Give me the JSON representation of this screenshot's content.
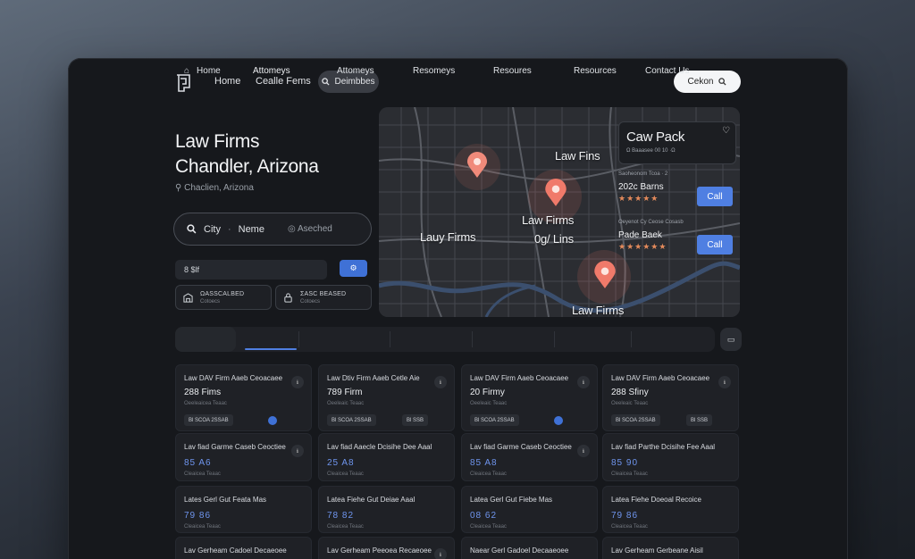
{
  "nav": {
    "home": "Home",
    "link2": "Cealle Fems",
    "pill": "Deimbbes",
    "search": "Cekon"
  },
  "hero": {
    "title_line1": "Law Firms",
    "title_line2": "Chandler, Arizona",
    "location": "Chaclien, Arizona"
  },
  "search": {
    "city": "City",
    "sep": "·",
    "name": "Neme",
    "checked": "Aseched"
  },
  "filter": {
    "value": "8 $lf"
  },
  "chips": [
    {
      "l1": "ΩASSCALBED",
      "l2": "Cotoecs"
    },
    {
      "l1": "ΣASC BEASED",
      "l2": "Cotoecs"
    }
  ],
  "map": {
    "labels": [
      "Law Fins",
      "Law Firms",
      "Lauy Firms",
      "0g/ Lins",
      "Law Firms"
    ],
    "card_title": "Caw Pack",
    "card_sub": "Ω Baaasee 00  10 ·Ω",
    "side1_small": "Saoheonom Tcoa · 2",
    "side1_name": "202c Barns",
    "side1_stars": "★★★★★",
    "side2_small": "Oeyenot Cy Ceose Cosasb",
    "side2_name": "Pade Baek",
    "side2_stars": "★★★★★★",
    "call": "Call"
  },
  "tabs": [
    "Home",
    "Attomeys",
    "Attomeys",
    "Resomeys",
    "Resoures",
    "Resources",
    "Contact Us"
  ],
  "cards_row1": [
    {
      "h": "Law DAV Firm Aaeb Ceoacaee",
      "n": "288 Fims",
      "m": "Oeeleaicea Teaac",
      "b1": "Bl  SCOA 2SSAB",
      "b2": "",
      "dot": true
    },
    {
      "h": "Law Dtiv Firm Aaeb Cetle Aie",
      "n": "789 Firm",
      "m": "Oeeleaic Teaac",
      "b1": "Bl  SCOA 2SSAB",
      "b2": "Bl  SSB",
      "dot": false
    },
    {
      "h": "Law DAV Firm Aaeb Ceoacaee",
      "n": "20 Firmy",
      "m": "Oeeleaic Teaac",
      "b1": "Bl  SCOA 2SSAB",
      "b2": "",
      "dot": true
    },
    {
      "h": "Law DAV Firm Aaeb Ceoacaee",
      "n": "288 Sfiny",
      "m": "Oeeleaic Teaac",
      "b1": "Bl  SCOA 2SSAB",
      "b2": "Bl  SSB",
      "dot": false
    }
  ],
  "cards_row2": [
    {
      "h": "Lav fiad Garme Caseb Ceoctiee",
      "v": "85 A6",
      "sm": "Cleaicea Teaac"
    },
    {
      "h": "Lav fiad Aaecle Dcisihe Dee Aaal",
      "v": "25 A8",
      "sm": "Cleaicea Teaac"
    },
    {
      "h": "Lav fiad Garme Caseb Ceoctiee",
      "v": "85 A8",
      "sm": "Cleaicea Teaac"
    },
    {
      "h": "Lav fiad Parthe Dcisihe Fee Aaal",
      "v": "85 90",
      "sm": "Cleaicea Teaac"
    }
  ],
  "cards_row3": [
    {
      "h": "Lates Gerl Gut Feata Mas",
      "v": "79 86",
      "sm": "Cleaicea Teaac"
    },
    {
      "h": "Latea Fiehe Gut Deiae Aaal",
      "v": "78 82",
      "sm": "Cleaicea Teaac"
    },
    {
      "h": "Latea Gerl Gut Fiebe Mas",
      "v": "08 62",
      "sm": "Cleaicea Teaac"
    },
    {
      "h": "Latea Fiehe Doeoal Recoice",
      "v": "79 86",
      "sm": "Cleaicea Teaac"
    }
  ],
  "cards_row4": [
    {
      "h": "Lav Gerheam Cadoel Decaeoee"
    },
    {
      "h": "Lav Gerheam Peeoea Recaeoee"
    },
    {
      "h": "Naear Gerl Gadoel Decaaeoee"
    },
    {
      "h": "Lav Gerheam Gerbeane Aisil"
    }
  ],
  "colors": {
    "accent": "#4f7fe2",
    "pin": "#f07a6a"
  }
}
